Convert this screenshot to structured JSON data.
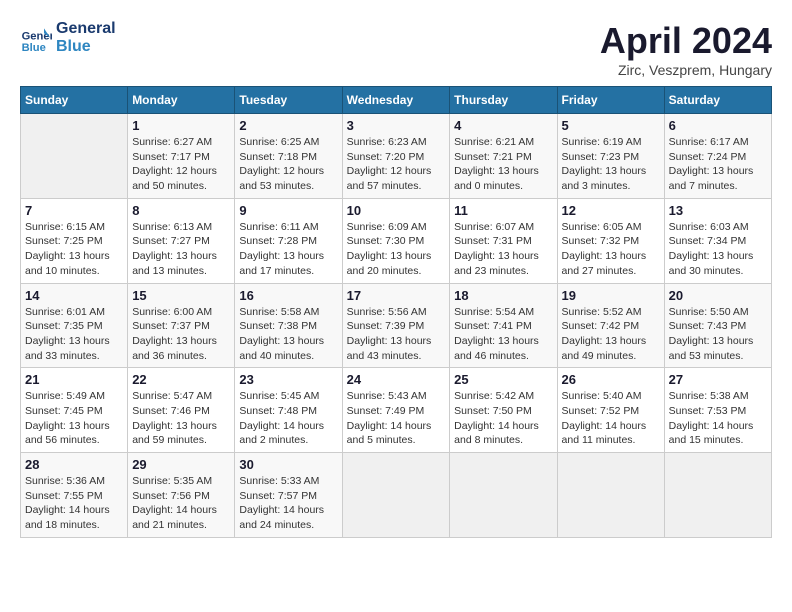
{
  "logo": {
    "line1": "General",
    "line2": "Blue"
  },
  "title": "April 2024",
  "subtitle": "Zirc, Veszprem, Hungary",
  "weekdays": [
    "Sunday",
    "Monday",
    "Tuesday",
    "Wednesday",
    "Thursday",
    "Friday",
    "Saturday"
  ],
  "weeks": [
    [
      {
        "day": "",
        "info": ""
      },
      {
        "day": "1",
        "info": "Sunrise: 6:27 AM\nSunset: 7:17 PM\nDaylight: 12 hours\nand 50 minutes."
      },
      {
        "day": "2",
        "info": "Sunrise: 6:25 AM\nSunset: 7:18 PM\nDaylight: 12 hours\nand 53 minutes."
      },
      {
        "day": "3",
        "info": "Sunrise: 6:23 AM\nSunset: 7:20 PM\nDaylight: 12 hours\nand 57 minutes."
      },
      {
        "day": "4",
        "info": "Sunrise: 6:21 AM\nSunset: 7:21 PM\nDaylight: 13 hours\nand 0 minutes."
      },
      {
        "day": "5",
        "info": "Sunrise: 6:19 AM\nSunset: 7:23 PM\nDaylight: 13 hours\nand 3 minutes."
      },
      {
        "day": "6",
        "info": "Sunrise: 6:17 AM\nSunset: 7:24 PM\nDaylight: 13 hours\nand 7 minutes."
      }
    ],
    [
      {
        "day": "7",
        "info": "Sunrise: 6:15 AM\nSunset: 7:25 PM\nDaylight: 13 hours\nand 10 minutes."
      },
      {
        "day": "8",
        "info": "Sunrise: 6:13 AM\nSunset: 7:27 PM\nDaylight: 13 hours\nand 13 minutes."
      },
      {
        "day": "9",
        "info": "Sunrise: 6:11 AM\nSunset: 7:28 PM\nDaylight: 13 hours\nand 17 minutes."
      },
      {
        "day": "10",
        "info": "Sunrise: 6:09 AM\nSunset: 7:30 PM\nDaylight: 13 hours\nand 20 minutes."
      },
      {
        "day": "11",
        "info": "Sunrise: 6:07 AM\nSunset: 7:31 PM\nDaylight: 13 hours\nand 23 minutes."
      },
      {
        "day": "12",
        "info": "Sunrise: 6:05 AM\nSunset: 7:32 PM\nDaylight: 13 hours\nand 27 minutes."
      },
      {
        "day": "13",
        "info": "Sunrise: 6:03 AM\nSunset: 7:34 PM\nDaylight: 13 hours\nand 30 minutes."
      }
    ],
    [
      {
        "day": "14",
        "info": "Sunrise: 6:01 AM\nSunset: 7:35 PM\nDaylight: 13 hours\nand 33 minutes."
      },
      {
        "day": "15",
        "info": "Sunrise: 6:00 AM\nSunset: 7:37 PM\nDaylight: 13 hours\nand 36 minutes."
      },
      {
        "day": "16",
        "info": "Sunrise: 5:58 AM\nSunset: 7:38 PM\nDaylight: 13 hours\nand 40 minutes."
      },
      {
        "day": "17",
        "info": "Sunrise: 5:56 AM\nSunset: 7:39 PM\nDaylight: 13 hours\nand 43 minutes."
      },
      {
        "day": "18",
        "info": "Sunrise: 5:54 AM\nSunset: 7:41 PM\nDaylight: 13 hours\nand 46 minutes."
      },
      {
        "day": "19",
        "info": "Sunrise: 5:52 AM\nSunset: 7:42 PM\nDaylight: 13 hours\nand 49 minutes."
      },
      {
        "day": "20",
        "info": "Sunrise: 5:50 AM\nSunset: 7:43 PM\nDaylight: 13 hours\nand 53 minutes."
      }
    ],
    [
      {
        "day": "21",
        "info": "Sunrise: 5:49 AM\nSunset: 7:45 PM\nDaylight: 13 hours\nand 56 minutes."
      },
      {
        "day": "22",
        "info": "Sunrise: 5:47 AM\nSunset: 7:46 PM\nDaylight: 13 hours\nand 59 minutes."
      },
      {
        "day": "23",
        "info": "Sunrise: 5:45 AM\nSunset: 7:48 PM\nDaylight: 14 hours\nand 2 minutes."
      },
      {
        "day": "24",
        "info": "Sunrise: 5:43 AM\nSunset: 7:49 PM\nDaylight: 14 hours\nand 5 minutes."
      },
      {
        "day": "25",
        "info": "Sunrise: 5:42 AM\nSunset: 7:50 PM\nDaylight: 14 hours\nand 8 minutes."
      },
      {
        "day": "26",
        "info": "Sunrise: 5:40 AM\nSunset: 7:52 PM\nDaylight: 14 hours\nand 11 minutes."
      },
      {
        "day": "27",
        "info": "Sunrise: 5:38 AM\nSunset: 7:53 PM\nDaylight: 14 hours\nand 15 minutes."
      }
    ],
    [
      {
        "day": "28",
        "info": "Sunrise: 5:36 AM\nSunset: 7:55 PM\nDaylight: 14 hours\nand 18 minutes."
      },
      {
        "day": "29",
        "info": "Sunrise: 5:35 AM\nSunset: 7:56 PM\nDaylight: 14 hours\nand 21 minutes."
      },
      {
        "day": "30",
        "info": "Sunrise: 5:33 AM\nSunset: 7:57 PM\nDaylight: 14 hours\nand 24 minutes."
      },
      {
        "day": "",
        "info": ""
      },
      {
        "day": "",
        "info": ""
      },
      {
        "day": "",
        "info": ""
      },
      {
        "day": "",
        "info": ""
      }
    ]
  ]
}
